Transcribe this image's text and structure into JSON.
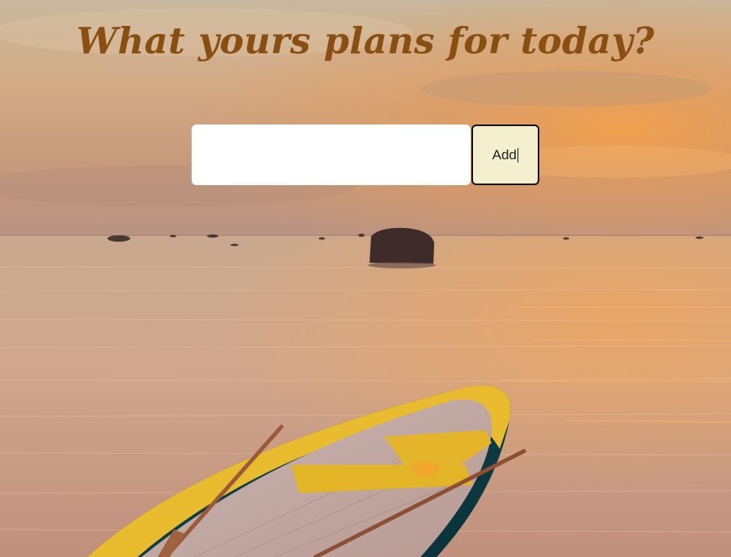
{
  "header": {
    "title": "What yours plans for today?"
  },
  "form": {
    "task_input_value": "",
    "task_input_placeholder": "",
    "add_label": "Add"
  },
  "colors": {
    "title": "#8a4f10",
    "button_bg": "#f4efcf",
    "input_bg": "#ffffff"
  }
}
